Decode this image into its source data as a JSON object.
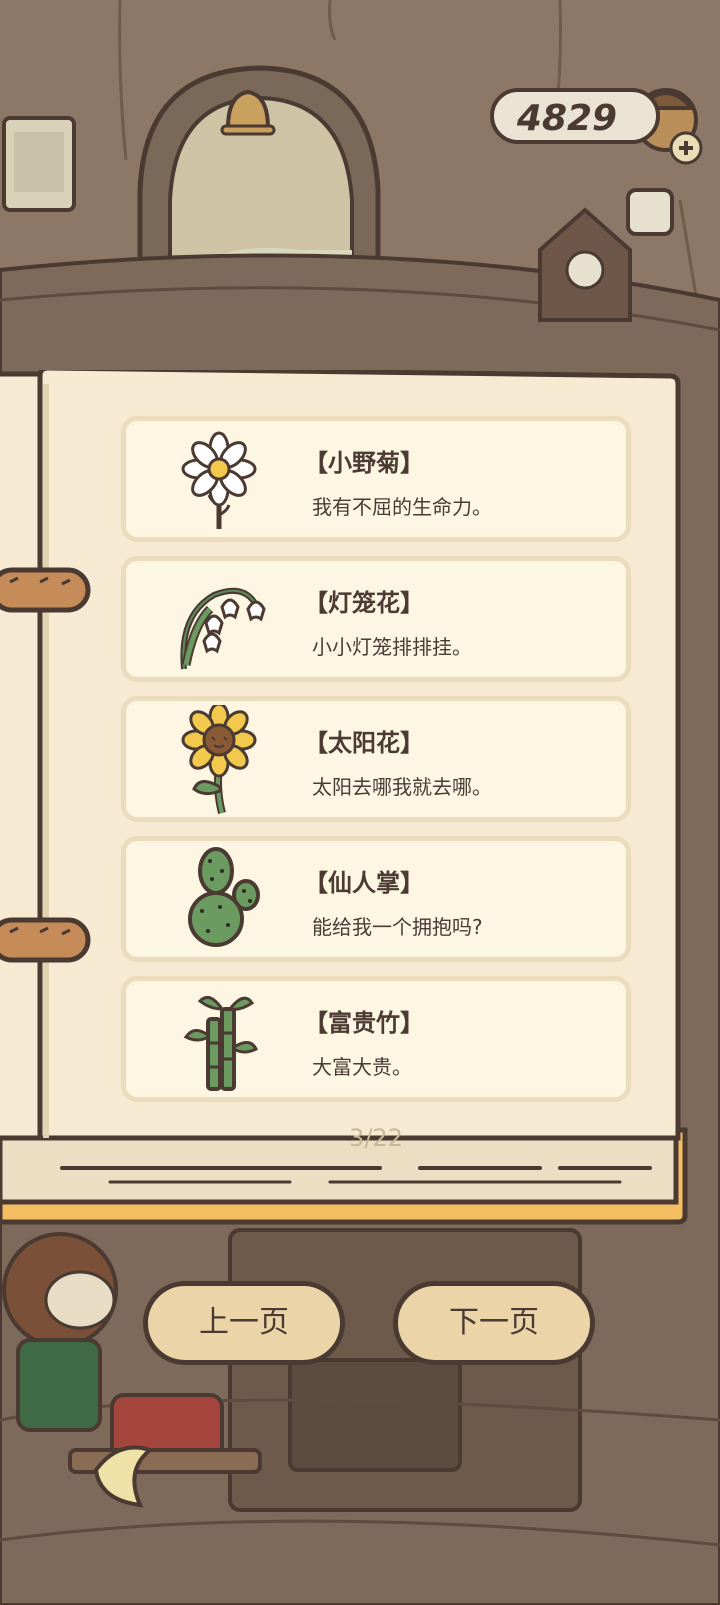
{
  "coins": {
    "value": "4829"
  },
  "book": {
    "items": [
      {
        "name": "【小野菊】",
        "desc": "我有不屈的生命力。",
        "icon": "daisy-icon"
      },
      {
        "name": "【灯笼花】",
        "desc": "小小灯笼排排挂。",
        "icon": "lily-of-valley-icon"
      },
      {
        "name": "【太阳花】",
        "desc": "太阳去哪我就去哪。",
        "icon": "sunflower-icon"
      },
      {
        "name": "【仙人掌】",
        "desc": "能给我一个拥抱吗?",
        "icon": "cactus-icon"
      },
      {
        "name": "【富贵竹】",
        "desc": "大富大贵。",
        "icon": "lucky-bamboo-icon"
      }
    ],
    "page_indicator": "3/22"
  },
  "nav": {
    "prev_label": "上一页",
    "next_label": "下一页"
  },
  "colors": {
    "card_bg": "#fdf6e3",
    "button_bg": "#ebd4a8",
    "outline": "#4a3a32",
    "page_bg": "#f6ebd2"
  }
}
